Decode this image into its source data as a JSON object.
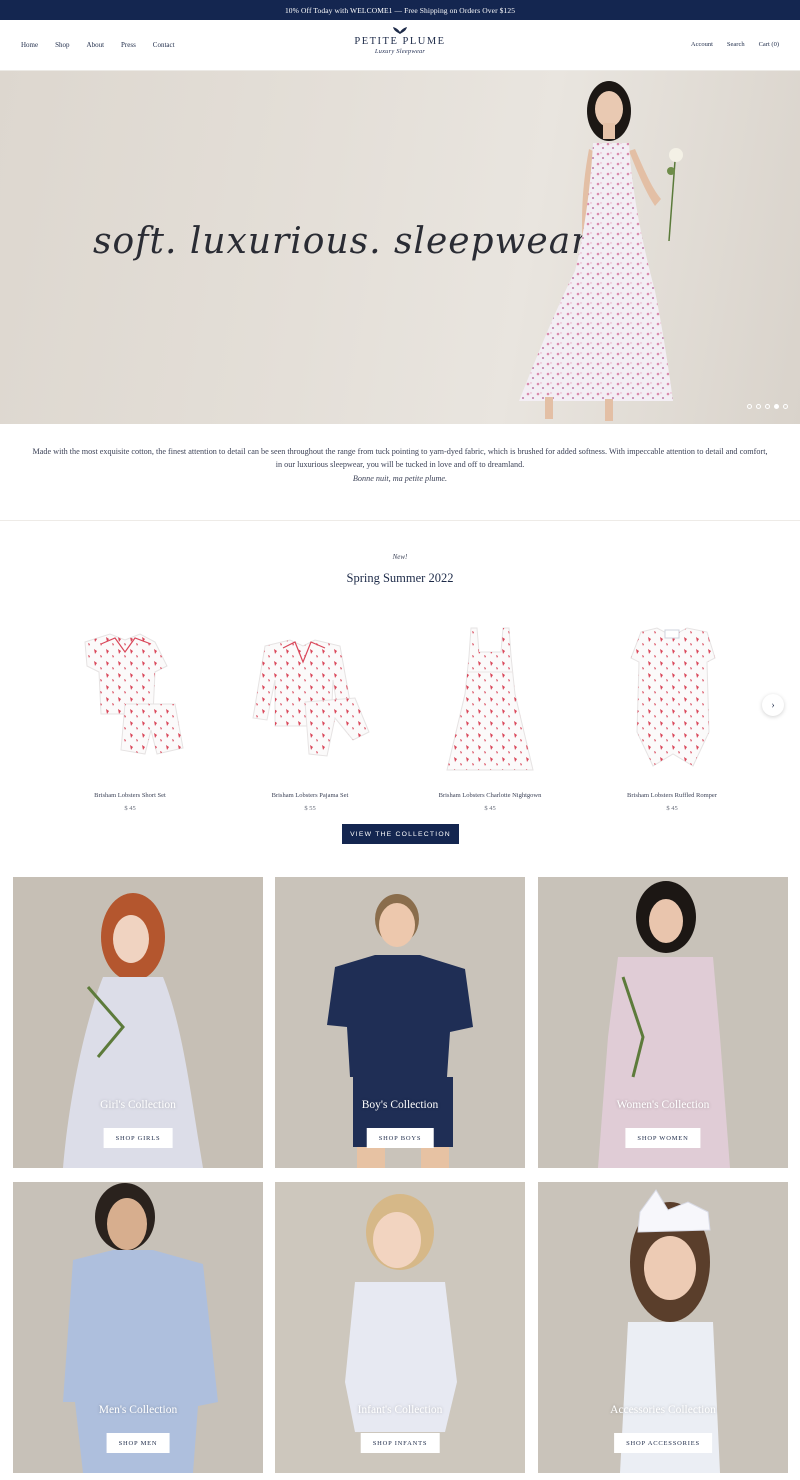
{
  "announcement": "10% Off Today with WELCOME1 — Free Shipping on Orders Over $125",
  "nav": {
    "left": [
      "Home",
      "Shop",
      "About",
      "Press",
      "Contact"
    ],
    "account": "Account",
    "search": "Search",
    "cart": "Cart (0)"
  },
  "logo": {
    "name": "PETITE PLUME",
    "tagline": "Luxury Sleepwear"
  },
  "hero": {
    "headline": "soft. luxurious. sleepwear.",
    "slides_total": 5,
    "active_slide": 4
  },
  "intro": {
    "body": "Made with the most exquisite cotton, the finest attention to detail can be seen throughout the range from tuck pointing to yarn-dyed fabric, which is brushed for added softness. With impeccable attention to detail and comfort, in our luxurious sleepwear, you will be tucked in love and off to dreamland.",
    "signoff": "Bonne nuit, ma petite plume."
  },
  "collection": {
    "label": "New!",
    "title": "Spring Summer 2022",
    "products": [
      {
        "name": "Brisham Lobsters Short Set",
        "price": "$ 45"
      },
      {
        "name": "Brisham Lobsters Pajama Set",
        "price": "$ 55"
      },
      {
        "name": "Brisham Lobsters Charlotte Nightgown",
        "price": "$ 45"
      },
      {
        "name": "Brisham Lobsters Ruffled Romper",
        "price": "$ 45"
      }
    ],
    "cta": "VIEW THE COLLECTION"
  },
  "categories": [
    {
      "title": "Girl's Collection",
      "button": "SHOP GIRLS"
    },
    {
      "title": "Boy's Collection",
      "button": "SHOP BOYS"
    },
    {
      "title": "Women's Collection",
      "button": "SHOP WOMEN"
    },
    {
      "title": "Men's Collection",
      "button": "SHOP MEN"
    },
    {
      "title": "Infant's Collection",
      "button": "SHOP INFANTS"
    },
    {
      "title": "Accessories Collection",
      "button": "SHOP ACCESSORIES"
    }
  ],
  "colors": {
    "navy": "#142650",
    "text": "#1d2a48",
    "hero_bg": "#e4dfd8",
    "tile_bg": "#c9c2b8",
    "print_red": "#d9475a"
  }
}
